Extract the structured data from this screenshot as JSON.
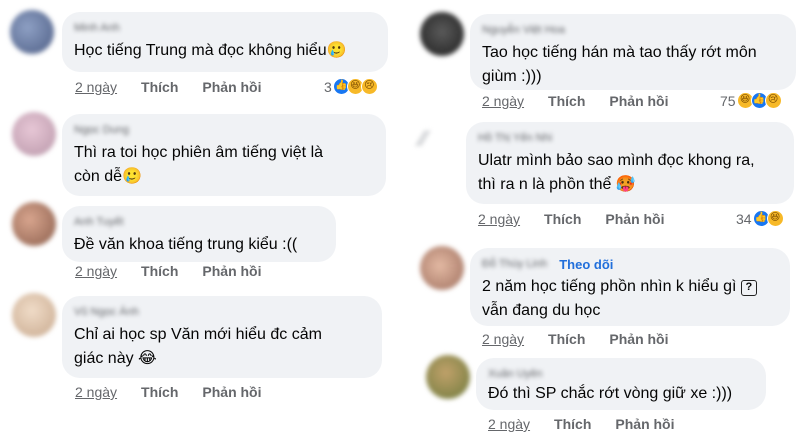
{
  "comments": [
    {
      "author": "Minh Anh",
      "text": [
        "Học tiếng Trung mà đọc không hiểu🥲"
      ],
      "time": "2 ngày",
      "like": "Thích",
      "reply": "Phản hồi",
      "count": "3",
      "reactions": [
        "like",
        "haha",
        "sad"
      ]
    },
    {
      "author": "Ngọc Dung",
      "text": [
        "Thì ra toi học phiên âm tiếng việt là",
        "còn dễ🥲"
      ],
      "time": "",
      "like": "",
      "reply": "",
      "count": "",
      "reactions": []
    },
    {
      "author": "Anh Tuyết",
      "text": [
        "Đề văn khoa tiếng trung kiểu :(("
      ],
      "time": "2 ngày",
      "like": "Thích",
      "reply": "Phản hồi",
      "count": "",
      "reactions": []
    },
    {
      "author": "Vũ Ngọc Ánh",
      "text": [
        "Chỉ ai học sp Văn mới hiểu đc cảm",
        "giác này 😂"
      ],
      "time": "2 ngày",
      "like": "Thích",
      "reply": "Phản hồi",
      "count": "",
      "reactions": []
    },
    {
      "author": "Nguyễn Việt Hoa",
      "text": [
        "Tao học tiếng hán mà tao thấy rớt môn",
        "giùm :)))"
      ],
      "time": "2 ngày",
      "like": "Thích",
      "reply": "Phản hồi",
      "count": "75",
      "reactions": [
        "haha",
        "like",
        "sad"
      ]
    },
    {
      "author": "Hồ Thị Yến Nhi",
      "text": [
        "Ulatr mình bảo sao mình đọc khong ra,",
        "thì ra n là phồn thể 🥵"
      ],
      "time": "2 ngày",
      "like": "Thích",
      "reply": "Phản hồi",
      "count": "34",
      "reactions": [
        "like",
        "haha"
      ]
    },
    {
      "author": "Đỗ Thùy Linh",
      "follow": "Theo dõi",
      "text_a": "2 năm học tiếng phồn nhìn k hiểu gì",
      "qmark": "?",
      "text_b": "vẫn đang du học",
      "time": "2 ngày",
      "like": "Thích",
      "reply": "Phản hồi"
    },
    {
      "author": "Xuân Uyên",
      "text": [
        "Đó thì SP chắc rớt vòng giữ xe :)))"
      ],
      "time": "2 ngày",
      "like": "Thích",
      "reply": "Phản hồi",
      "count": "",
      "reactions": []
    }
  ],
  "reaction_icons": {
    "like": "👍",
    "haha": "😆",
    "sad": "😢"
  },
  "colors": {
    "bubble": "#f0f2f5",
    "meta": "#65676b",
    "follow": "#216fdb",
    "like": "#1877f2",
    "emoji": "#f7b928"
  }
}
